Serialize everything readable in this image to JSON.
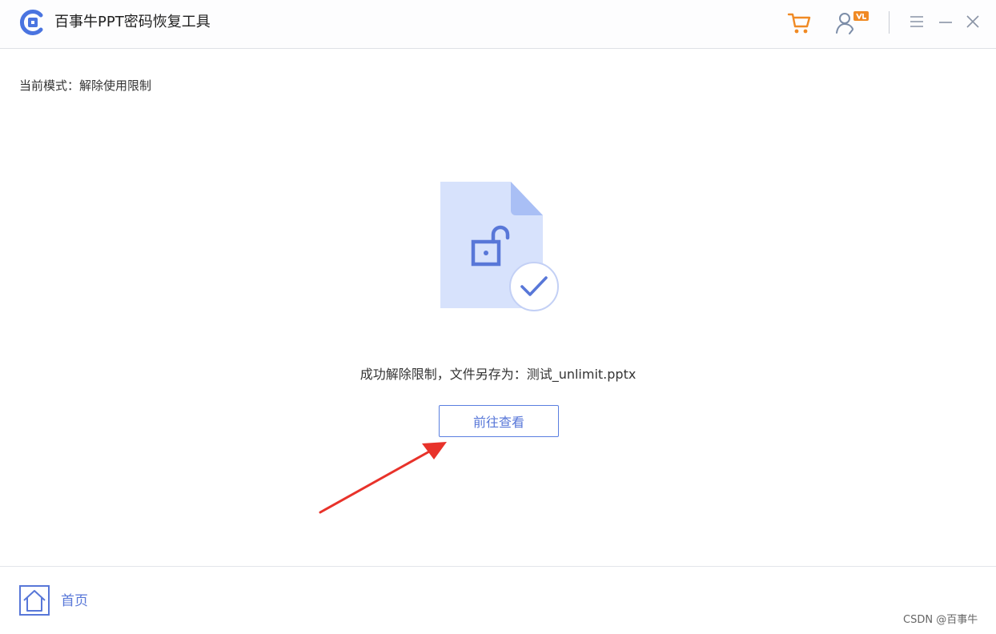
{
  "titlebar": {
    "title": "百事牛PPT密码恢复工具",
    "icons": [
      "app-logo-icon",
      "cart-icon",
      "user-vip-icon",
      "menu-icon",
      "minimize-icon",
      "close-icon"
    ]
  },
  "mode": {
    "text": "当前模式：解除使用限制"
  },
  "result": {
    "message": "成功解除限制，文件另存为：测试_unlimit.pptx",
    "icons": [
      "unlocked-file-icon",
      "check-circle-icon"
    ]
  },
  "actions": {
    "view_label": "前往查看"
  },
  "footer": {
    "home_label": "首页",
    "home_icon": "home-icon"
  },
  "watermark": "CSDN @百事牛",
  "colors": {
    "accent": "#5877d8",
    "file_fill": "#d7e2fc",
    "cart": "#f08a24",
    "arrow": "#e8322a"
  }
}
